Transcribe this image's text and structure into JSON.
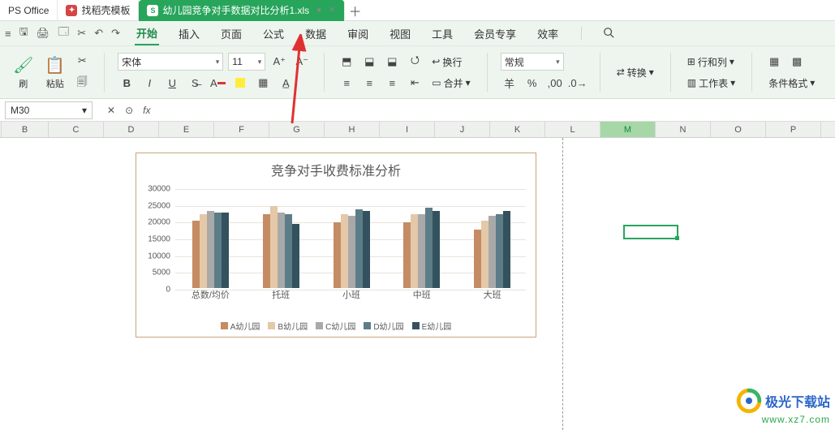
{
  "tabs": {
    "office": "PS Office",
    "template": "找稻壳模板",
    "active": "幼儿园竞争对手数据对比分析1.xls",
    "active_badge": "S"
  },
  "menu": {
    "items": [
      "开始",
      "插入",
      "页面",
      "公式",
      "数据",
      "审阅",
      "视图",
      "工具",
      "会员专享",
      "效率"
    ]
  },
  "toolbar": {
    "paste": "粘贴",
    "format_brush": "刷",
    "font_name": "宋体",
    "font_size": "11",
    "number_format": "常规",
    "convert": "转换",
    "rowcol": "行和列",
    "worksheet": "工作表",
    "cond_format": "条件格式",
    "wrap_main": "换行",
    "merge_main": "合并",
    "currency": "羊",
    "percent": "%"
  },
  "namebox": "M30",
  "columns": [
    "B",
    "C",
    "D",
    "E",
    "F",
    "G",
    "H",
    "I",
    "J",
    "K",
    "L",
    "M",
    "N",
    "O",
    "P"
  ],
  "active_col": "M",
  "chart_data": {
    "type": "bar",
    "title": "竞争对手收费标准分析",
    "y_ticks": [
      0,
      5000,
      10000,
      15000,
      20000,
      25000,
      30000
    ],
    "ylim": [
      0,
      30000
    ],
    "categories": [
      "总数/均价",
      "托班",
      "小班",
      "中班",
      "大班"
    ],
    "series": [
      {
        "name": "A幼儿园",
        "color": "#c58b64",
        "values": [
          20000,
          22000,
          19500,
          19500,
          17500
        ]
      },
      {
        "name": "B幼儿园",
        "color": "#e4c8a8",
        "values": [
          22000,
          24500,
          22000,
          22000,
          20000
        ]
      },
      {
        "name": "C幼儿园",
        "color": "#a9a9a9",
        "values": [
          23000,
          22500,
          21500,
          22000,
          21500
        ]
      },
      {
        "name": "D幼儿园",
        "color": "#5c7d88",
        "values": [
          22500,
          22000,
          23500,
          24000,
          22000
        ]
      },
      {
        "name": "E幼儿园",
        "color": "#33525e",
        "values": [
          22500,
          19000,
          23000,
          23000,
          23000
        ]
      }
    ]
  },
  "watermark": {
    "name": "极光下载站",
    "url": "www.xz7.com"
  }
}
